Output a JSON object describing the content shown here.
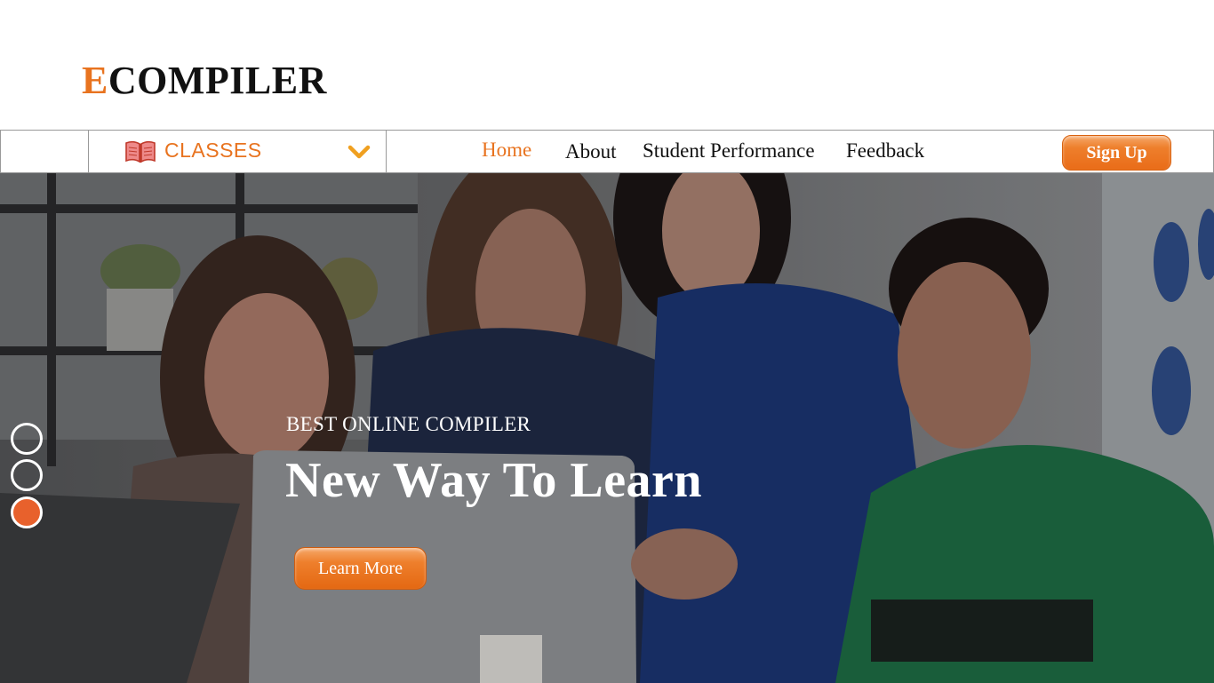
{
  "logo": {
    "first_letter": "E",
    "rest": "COMPILER"
  },
  "nav": {
    "classes_label": "CLASSES",
    "links": [
      {
        "label": "Home",
        "active": true
      },
      {
        "label": "About"
      },
      {
        "label": "Student Performance"
      },
      {
        "label": "Feedback"
      }
    ],
    "signup_label": "Sign Up",
    "accent_color": "#e8731f"
  },
  "hero": {
    "subtitle": "BEST ONLINE COMPILER",
    "title": "New Way To Learn",
    "cta_label": "Learn More",
    "slides": [
      {
        "active": false
      },
      {
        "active": false
      },
      {
        "active": true
      }
    ],
    "active_dot_color": "#e8612c"
  },
  "icons": {
    "classes": "book-icon",
    "dropdown": "chevron-down-icon"
  }
}
